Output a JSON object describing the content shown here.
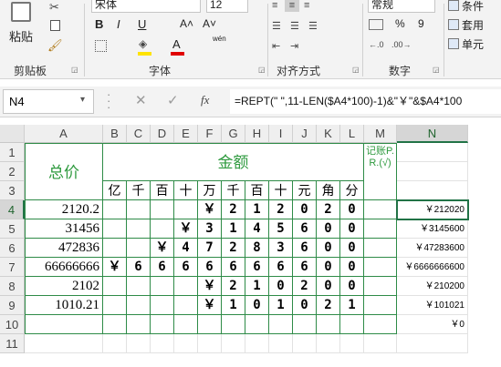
{
  "ribbon": {
    "clipboard": {
      "paste_label": "粘贴",
      "group_label": "剪贴板"
    },
    "font": {
      "font_name": "宋体",
      "font_size": "12",
      "bold": "B",
      "italic": "I",
      "underline": "U",
      "grow": "A˄",
      "shrink": "A˅",
      "font_color_letter": "A",
      "phonetic": "wén",
      "group_label": "字体"
    },
    "alignment": {
      "group_label": "对齐方式"
    },
    "number": {
      "format": "常规",
      "percent": "%",
      "comma": "9",
      "group_label": "数字"
    },
    "styles": {
      "conditional": "条件",
      "table": "套用",
      "cell": "单元"
    }
  },
  "formula_bar": {
    "name_box": "N4",
    "fx": "fx",
    "formula": "=REPT(\" \",11-LEN($A4*100)-1)&\"￥\"&$A4*100"
  },
  "columns": [
    "A",
    "B",
    "C",
    "D",
    "E",
    "F",
    "G",
    "H",
    "I",
    "J",
    "K",
    "L",
    "M",
    "N"
  ],
  "rows": [
    "1",
    "2",
    "3",
    "4",
    "5",
    "6",
    "7",
    "8",
    "9",
    "10",
    "11"
  ],
  "sheet": {
    "header_total": "总价",
    "header_amount": "金额",
    "header_ledger": "记账P.R.(√)",
    "units": [
      "亿",
      "千",
      "百",
      "十",
      "万",
      "千",
      "百",
      "十",
      "元",
      "角",
      "分"
    ],
    "a_values": [
      "2120.2",
      "31456",
      "472836",
      "66666666",
      "2102",
      "1010.21"
    ],
    "digits": [
      [
        "",
        "",
        "",
        "",
        "￥",
        "2",
        "1",
        "2",
        "0",
        "2",
        "0"
      ],
      [
        "",
        "",
        "",
        "￥",
        "3",
        "1",
        "4",
        "5",
        "6",
        "0",
        "0"
      ],
      [
        "",
        "",
        "￥",
        "4",
        "7",
        "2",
        "8",
        "3",
        "6",
        "0",
        "0"
      ],
      [
        "￥",
        "6",
        "6",
        "6",
        "6",
        "6",
        "6",
        "6",
        "6",
        "0",
        "0"
      ],
      [
        "",
        "",
        "",
        "",
        "￥",
        "2",
        "1",
        "0",
        "2",
        "0",
        "0"
      ],
      [
        "",
        "",
        "",
        "",
        "￥",
        "1",
        "0",
        "1",
        "0",
        "2",
        "1"
      ]
    ],
    "n_values": [
      "￥212020",
      "￥3145600",
      "￥47283600",
      "￥6666666600",
      "￥210200",
      "￥101021",
      "￥0"
    ]
  }
}
